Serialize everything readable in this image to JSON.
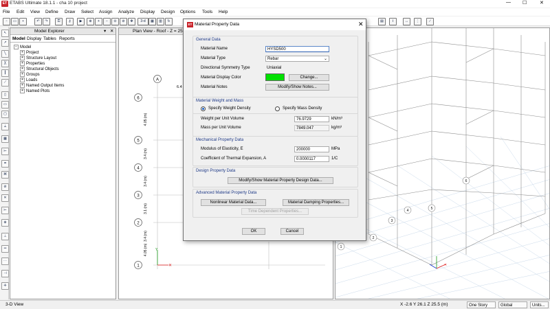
{
  "app": {
    "logo_text": "ET",
    "title": "ETABS Ultimate 18.1.1 - cha 10 project",
    "title_controls": {
      "min": "—",
      "max": "☐",
      "close": "✕"
    }
  },
  "menu": [
    "File",
    "Edit",
    "View",
    "Define",
    "Draw",
    "Select",
    "Assign",
    "Analyze",
    "Display",
    "Design",
    "Options",
    "Tools",
    "Help"
  ],
  "toolbar": {
    "threed_label": "3-d"
  },
  "model_explorer": {
    "title": "Model Explorer",
    "tabs": [
      "Model",
      "Display",
      "Tables",
      "Reports"
    ],
    "root": "Model",
    "items": [
      "Project",
      "Structure Layout",
      "Properties",
      "Structural Objects",
      "Groups",
      "Loads",
      "Named Output Items",
      "Named Plots"
    ]
  },
  "plan_view": {
    "title": "Plan View - Roof - Z = 25.5",
    "grid_col": "A",
    "dimension": "6.4",
    "grid_rows": [
      "6",
      "5",
      "4",
      "3",
      "2",
      "1"
    ],
    "spacings": [
      "4.05 (m)",
      "3.4 (m)",
      "3.4 (m)",
      "3.1 (m)",
      "3.4 (m)",
      "4.05 (m)"
    ]
  },
  "view3d": {
    "grid_bubbles": [
      "1",
      "2",
      "3",
      "4",
      "5",
      "6"
    ]
  },
  "dialog": {
    "logo_text": "ET",
    "title": "Material Property Data",
    "close": "✕",
    "general": {
      "heading": "General Data",
      "name_label": "Material Name",
      "name_value": "HYSD500",
      "type_label": "Material Type",
      "type_value": "Rebar",
      "symmetry_label": "Directional Symmetry Type",
      "symmetry_value": "Uniaxial",
      "color_label": "Material Display Color",
      "color_value": "#00e000",
      "change_button": "Change...",
      "notes_label": "Material Notes",
      "notes_button": "Modify/Show Notes..."
    },
    "weight": {
      "heading": "Material Weight and Mass",
      "radio_weight": "Specify Weight Density",
      "radio_mass": "Specify Mass Density",
      "weight_label": "Weight per Unit Volume",
      "weight_value": "76.9729",
      "weight_unit": "kN/m³",
      "mass_label": "Mass per Unit Volume",
      "mass_value": "7849.047",
      "mass_unit": "kg/m³"
    },
    "mechanical": {
      "heading": "Mechanical Property Data",
      "modulus_label": "Modulus of Elasticity,  E",
      "modulus_value": "200000",
      "modulus_unit": "MPa",
      "thermal_label": "Coefficient of Thermal Expansion,  A",
      "thermal_value": "0.0000117",
      "thermal_unit": "1/C"
    },
    "design": {
      "heading": "Design Property Data",
      "button": "Modify/Show Material Property Design Data..."
    },
    "advanced": {
      "heading": "Advanced Material Property Data",
      "nonlinear_button": "Nonlinear Material Data...",
      "damping_button": "Material Damping Properties...",
      "time_button": "Time Dependent Properties..."
    },
    "ok": "OK",
    "cancel": "Cancel"
  },
  "status": {
    "view": "3-D View",
    "coords": "X -2.6  Y 26.1  Z 25.5 (m)",
    "story": "One Story",
    "system": "Global",
    "units": "Units..."
  }
}
